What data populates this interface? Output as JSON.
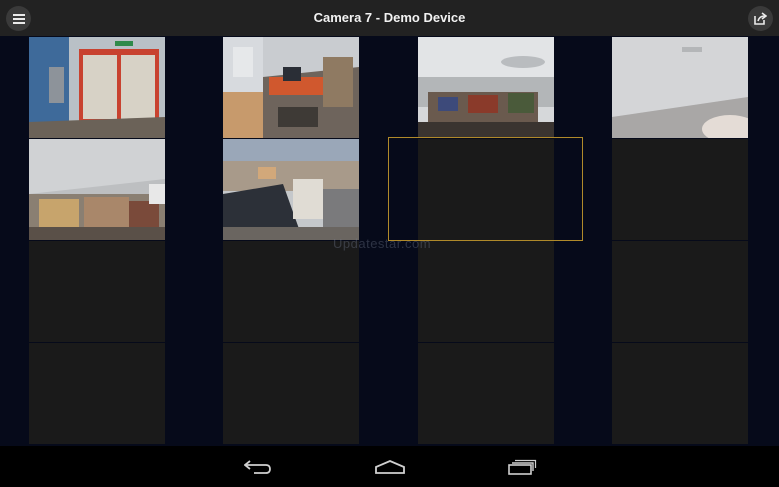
{
  "header": {
    "title": "Camera 7 - Demo Device",
    "menu_icon": "menu-icon",
    "share_icon": "share-icon"
  },
  "grid": {
    "columns": 4,
    "rows": 4,
    "tiles": [
      {
        "name": "camera-tile-1",
        "state": "live",
        "scene": "door"
      },
      {
        "name": "camera-tile-2",
        "state": "live",
        "scene": "office-desk"
      },
      {
        "name": "camera-tile-3",
        "state": "live",
        "scene": "office-overview"
      },
      {
        "name": "camera-tile-4",
        "state": "live",
        "scene": "corridor"
      },
      {
        "name": "camera-tile-5",
        "state": "live",
        "scene": "storage"
      },
      {
        "name": "camera-tile-6",
        "state": "live",
        "scene": "warehouse"
      },
      {
        "name": "camera-tile-7",
        "state": "empty-selected"
      },
      {
        "name": "camera-tile-8",
        "state": "empty"
      },
      {
        "name": "camera-tile-9",
        "state": "empty"
      },
      {
        "name": "camera-tile-10",
        "state": "empty"
      },
      {
        "name": "camera-tile-11",
        "state": "empty"
      },
      {
        "name": "camera-tile-12",
        "state": "empty"
      },
      {
        "name": "camera-tile-13",
        "state": "empty"
      },
      {
        "name": "camera-tile-14",
        "state": "empty"
      },
      {
        "name": "camera-tile-15",
        "state": "empty"
      },
      {
        "name": "camera-tile-16",
        "state": "empty"
      }
    ],
    "selected_tile": 7,
    "selection_color": "#b08a2a"
  },
  "watermark": "Updatestar.com",
  "navbar": {
    "back_icon": "back-icon",
    "home_icon": "home-icon",
    "recents_icon": "recent-apps-icon"
  }
}
